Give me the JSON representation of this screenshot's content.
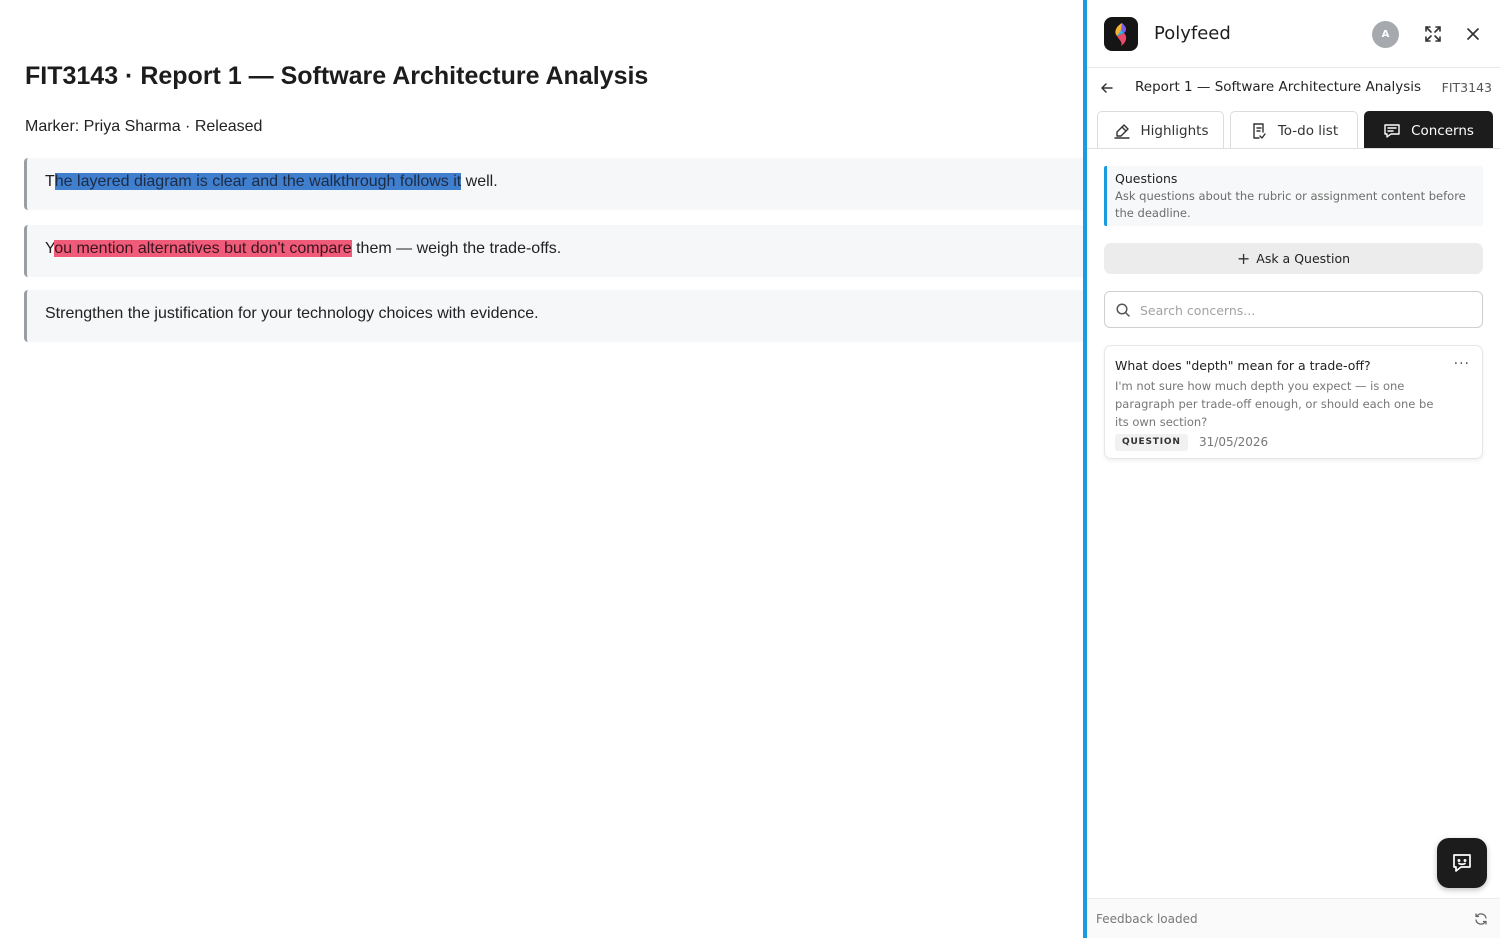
{
  "document": {
    "title": "FIT3143 · Report 1 — Software Architecture Analysis",
    "meta": "Marker: Priya Sharma · Released",
    "comments": [
      {
        "prefix": "T",
        "highlight": "he layered diagram is clear and the walkthrough follows it",
        "suffix": " well.",
        "highlight_color": "#3f7fce"
      },
      {
        "prefix": "Y",
        "highlight": "ou mention alternatives but don't compare",
        "suffix": " them — weigh the trade-offs.",
        "highlight_color": "#ef5b78"
      },
      {
        "text": "Strengthen the justification for your technology choices with evidence."
      }
    ]
  },
  "panel": {
    "brand": "Polyfeed",
    "accent_color": "#1a9be0",
    "avatar_initial": "A",
    "header_icons": [
      "expand-icon",
      "close-icon"
    ],
    "breadcrumb": {
      "title": "Report 1 — Software Architecture Analysis",
      "code": "FIT3143"
    },
    "tabs": [
      {
        "label": "Highlights",
        "icon": "highlighter-icon",
        "active": false
      },
      {
        "label": "To-do list",
        "icon": "checklist-icon",
        "active": false
      },
      {
        "label": "Concerns",
        "icon": "message-icon",
        "active": true
      }
    ],
    "info": {
      "title": "Questions",
      "text": "Ask questions about the rubric or assignment content before the deadline."
    },
    "ask_button": "Ask a Question",
    "search_placeholder": "Search concerns...",
    "concerns": [
      {
        "title": "What does \"depth\" mean for a trade-off?",
        "body": "I'm not sure how much depth you expect — is one paragraph per trade-off enough, or should each one be its own section?",
        "badge": "QUESTION",
        "date": "31/05/2026"
      }
    ],
    "footer_status": "Feedback loaded"
  }
}
